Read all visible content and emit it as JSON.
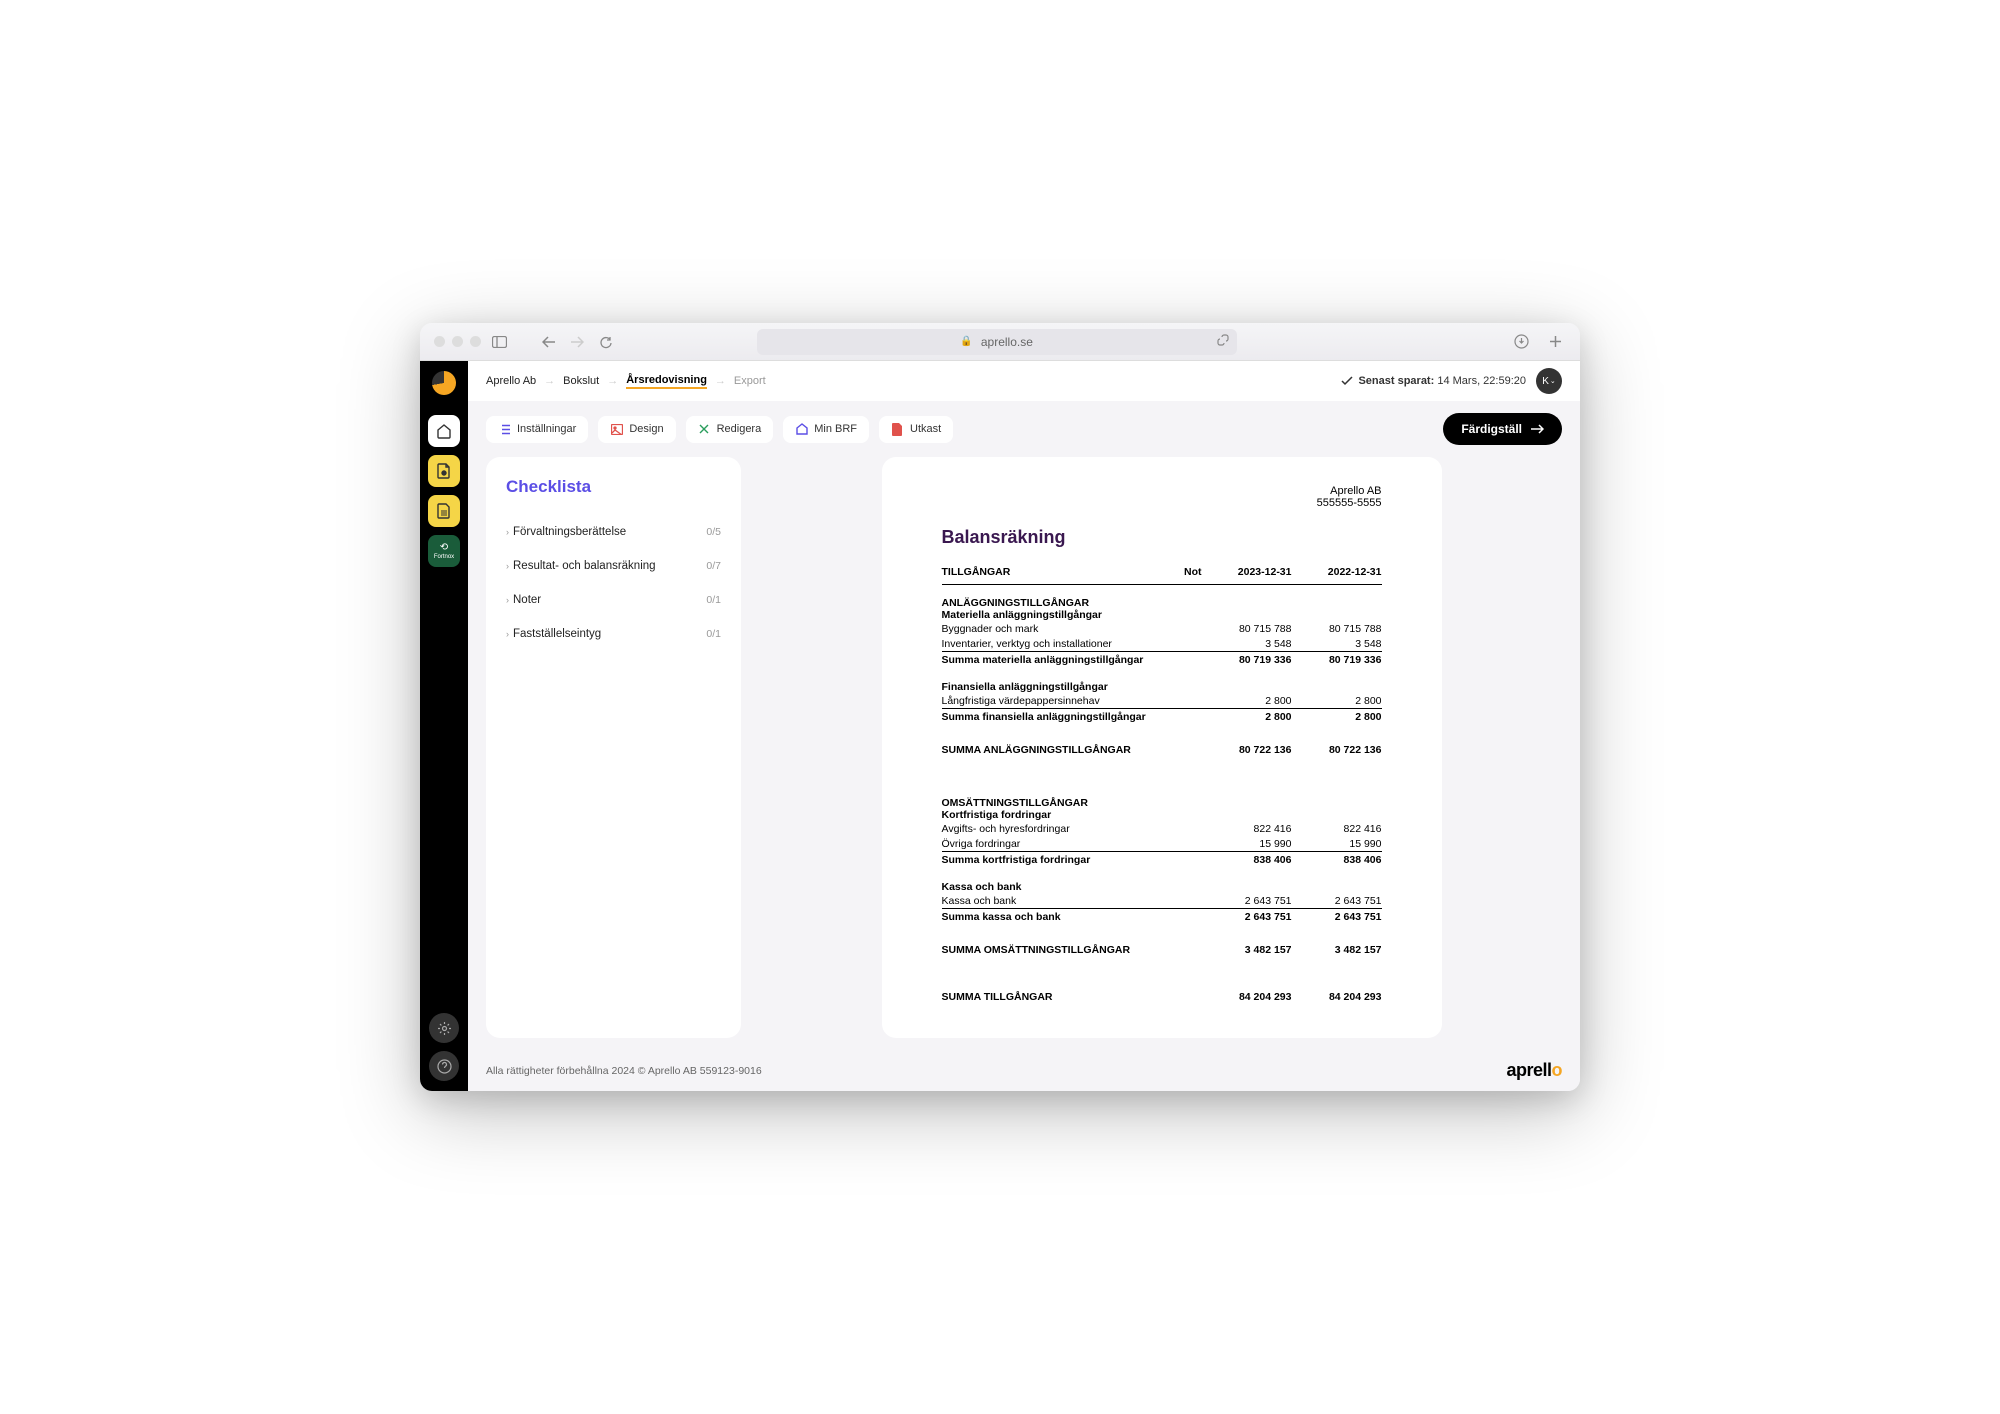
{
  "browser": {
    "url": "aprello.se"
  },
  "sidebar": {
    "fortnox_label": "Fortnox"
  },
  "breadcrumbs": [
    {
      "label": "Aprello Ab"
    },
    {
      "label": "Bokslut"
    },
    {
      "label": "Årsredovisning",
      "active": true
    },
    {
      "label": "Export",
      "muted": true
    }
  ],
  "saved": {
    "prefix": "Senast sparat:",
    "value": "14 Mars, 22:59:20"
  },
  "avatar_label": "K",
  "toolbar": {
    "settings": "Inställningar",
    "design": "Design",
    "edit": "Redigera",
    "brf": "Min BRF",
    "draft": "Utkast",
    "finalize": "Färdigställ"
  },
  "checklist": {
    "title": "Checklista",
    "items": [
      {
        "label": "Förvaltningsberättelse",
        "count": "0/5"
      },
      {
        "label": "Resultat- och balansräkning",
        "count": "0/7"
      },
      {
        "label": "Noter",
        "count": "0/1"
      },
      {
        "label": "Fastställelseintyg",
        "count": "0/1"
      }
    ]
  },
  "doc": {
    "company": "Aprello AB",
    "orgnr": "555555-5555",
    "title": "Balansräkning",
    "col_assets": "TILLGÅNGAR",
    "col_note": "Not",
    "col_y1": "2023-12-31",
    "col_y2": "2022-12-31",
    "sections": {
      "fixed_title": "ANLÄGGNINGSTILLGÅNGAR",
      "tangible_title": "Materiella anläggningstillgångar",
      "tangible_rows": [
        {
          "label": "Byggnader och mark",
          "y1": "80 715 788",
          "y2": "80 715 788"
        },
        {
          "label": "Inventarier, verktyg och installationer",
          "y1": "3 548",
          "y2": "3 548",
          "underline": true
        }
      ],
      "tangible_sum": {
        "label": "Summa materiella anläggningstillgångar",
        "y1": "80 719 336",
        "y2": "80 719 336"
      },
      "financial_title": "Finansiella anläggningstillgångar",
      "financial_rows": [
        {
          "label": "Långfristiga värdepappersinnehav",
          "y1": "2 800",
          "y2": "2 800",
          "underline": true
        }
      ],
      "financial_sum": {
        "label": "Summa finansiella anläggningstillgångar",
        "y1": "2 800",
        "y2": "2 800"
      },
      "fixed_sum": {
        "label": "SUMMA ANLÄGGNINGSTILLGÅNGAR",
        "y1": "80 722 136",
        "y2": "80 722 136"
      },
      "current_title": "OMSÄTTNINGSTILLGÅNGAR",
      "receivables_title": "Kortfristiga fordringar",
      "receivables_rows": [
        {
          "label": "Avgifts- och hyresfordringar",
          "y1": "822 416",
          "y2": "822 416"
        },
        {
          "label": "Övriga fordringar",
          "y1": "15 990",
          "y2": "15 990",
          "underline": true
        }
      ],
      "receivables_sum": {
        "label": "Summa kortfristiga fordringar",
        "y1": "838 406",
        "y2": "838 406"
      },
      "cash_title": "Kassa och bank",
      "cash_rows": [
        {
          "label": "Kassa och bank",
          "y1": "2 643 751",
          "y2": "2 643 751",
          "underline": true
        }
      ],
      "cash_sum": {
        "label": "Summa kassa och bank",
        "y1": "2 643 751",
        "y2": "2 643 751"
      },
      "current_sum": {
        "label": "SUMMA OMSÄTTNINGSTILLGÅNGAR",
        "y1": "3 482 157",
        "y2": "3 482 157"
      },
      "total": {
        "label": "SUMMA TILLGÅNGAR",
        "y1": "84 204 293",
        "y2": "84 204 293"
      }
    }
  },
  "footer": {
    "copyright": "Alla rättigheter förbehållna 2024 © Aprello AB 559123-9016"
  }
}
